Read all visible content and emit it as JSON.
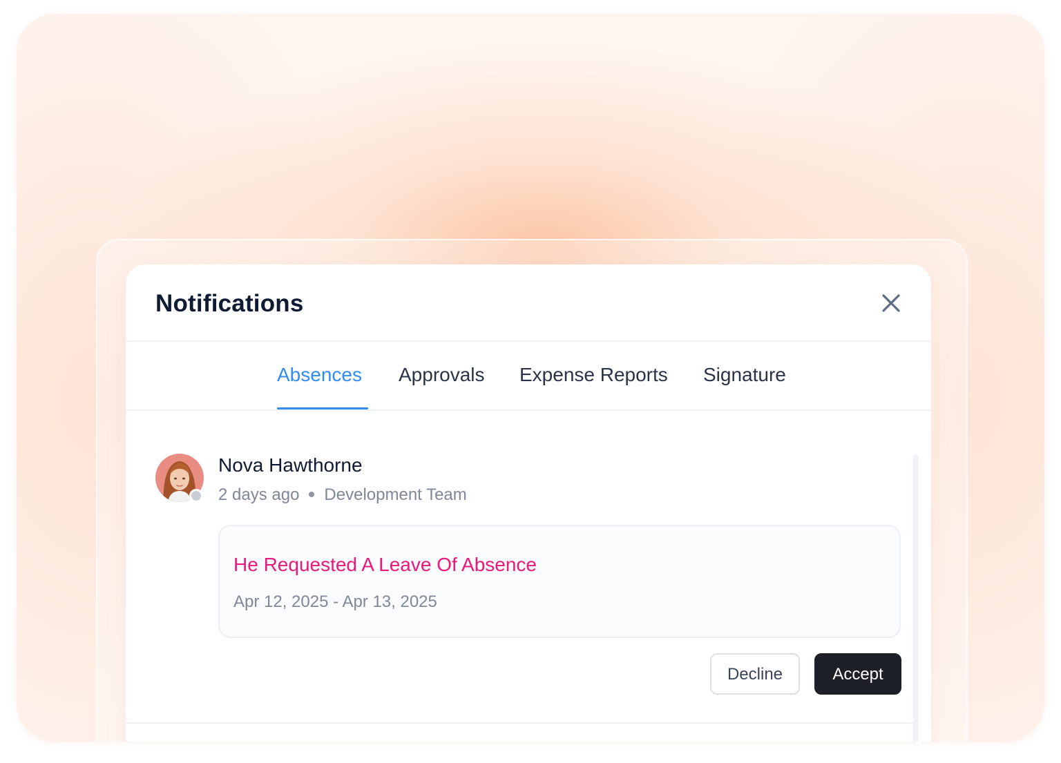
{
  "panel": {
    "title": "Notifications",
    "close_icon": "close-icon"
  },
  "tabs": [
    {
      "label": "Absences",
      "active": true
    },
    {
      "label": "Approvals",
      "active": false
    },
    {
      "label": "Expense Reports",
      "active": false
    },
    {
      "label": "Signature",
      "active": false
    }
  ],
  "notification": {
    "user_name": "Nova Hawthorne",
    "time_ago": "2 days ago",
    "team": "Development Team",
    "request_title": "He Requested A Leave Of Absence",
    "request_dates": "Apr 12, 2025 - Apr 13, 2025",
    "decline_label": "Decline",
    "accept_label": "Accept",
    "avatar_icon": "avatar-photo"
  },
  "colors": {
    "accent_blue": "#2f8cf5",
    "request_pink": "#e8197a",
    "title_dark": "#0f1a33",
    "accept_bg": "#1d2027"
  }
}
